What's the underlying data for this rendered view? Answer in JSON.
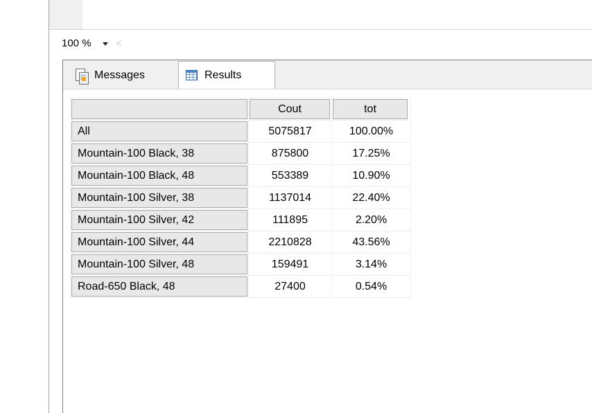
{
  "zoom": {
    "value": "100 %"
  },
  "tabs": [
    {
      "label": "Messages",
      "icon": "messages-icon"
    },
    {
      "label": "Results",
      "icon": "results-grid-icon"
    }
  ],
  "grid": {
    "columns": [
      "",
      "Cout",
      "tot"
    ],
    "rows": [
      {
        "label": "All",
        "cout": "5075817",
        "tot": "100.00%"
      },
      {
        "label": "Mountain-100 Black, 38",
        "cout": "875800",
        "tot": "17.25%"
      },
      {
        "label": "Mountain-100 Black, 48",
        "cout": "553389",
        "tot": "10.90%"
      },
      {
        "label": "Mountain-100 Silver, 38",
        "cout": "1137014",
        "tot": "22.40%"
      },
      {
        "label": "Mountain-100 Silver, 42",
        "cout": "111895",
        "tot": "2.20%"
      },
      {
        "label": "Mountain-100 Silver, 44",
        "cout": "2210828",
        "tot": "43.56%"
      },
      {
        "label": "Mountain-100 Silver, 48",
        "cout": "159491",
        "tot": "3.14%"
      },
      {
        "label": "Road-650 Black, 48",
        "cout": "27400",
        "tot": "0.54%"
      }
    ]
  }
}
